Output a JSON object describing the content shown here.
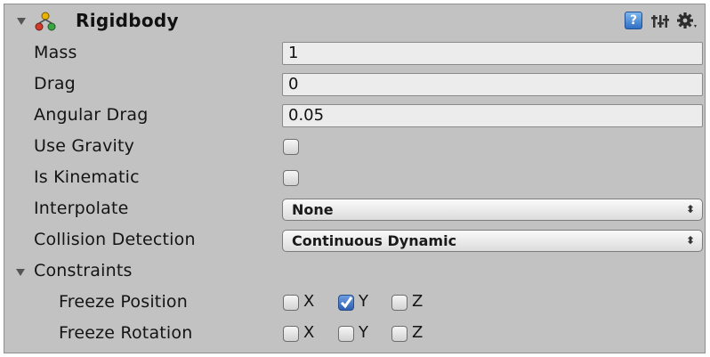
{
  "header": {
    "title": "Rigidbody",
    "help_icon_glyph": "?"
  },
  "fields": {
    "mass": {
      "label": "Mass",
      "value": "1"
    },
    "drag": {
      "label": "Drag",
      "value": "0"
    },
    "angular_drag": {
      "label": "Angular Drag",
      "value": "0.05"
    },
    "use_gravity": {
      "label": "Use Gravity",
      "checked": false
    },
    "is_kinematic": {
      "label": "Is Kinematic",
      "checked": false
    },
    "interpolate": {
      "label": "Interpolate",
      "value": "None"
    },
    "collision_detection": {
      "label": "Collision Detection",
      "value": "Continuous Dynamic"
    }
  },
  "constraints": {
    "label": "Constraints",
    "freeze_position": {
      "label": "Freeze Position",
      "axes": [
        {
          "name": "X",
          "checked": false
        },
        {
          "name": "Y",
          "checked": true
        },
        {
          "name": "Z",
          "checked": false
        }
      ]
    },
    "freeze_rotation": {
      "label": "Freeze Rotation",
      "axes": [
        {
          "name": "X",
          "checked": false
        },
        {
          "name": "Y",
          "checked": false
        },
        {
          "name": "Z",
          "checked": false
        }
      ]
    }
  },
  "dropdown_glyph": "⬍",
  "colors": {
    "panel_background": "#c2c2c2",
    "field_background": "#ececec",
    "checkbox_checked": "#2d5fb1"
  }
}
